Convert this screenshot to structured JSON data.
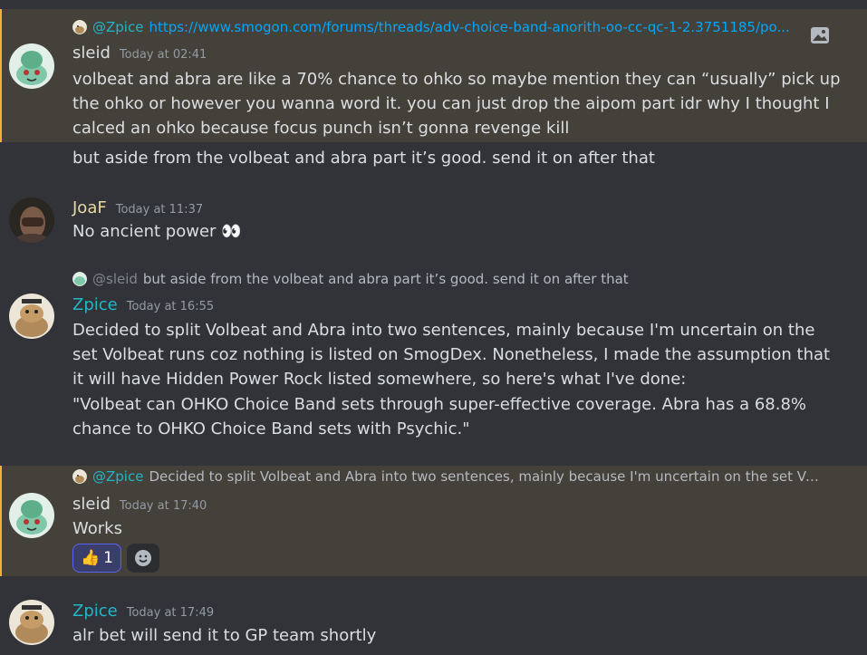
{
  "users": {
    "sleid": {
      "name": "sleid"
    },
    "joaf": {
      "name": "JoaF"
    },
    "zpice": {
      "name": "Zpice"
    }
  },
  "messages": [
    {
      "author": "sleid",
      "timestamp": "Today at 02:41",
      "reply": {
        "mention": "@Zpice",
        "text": "https://www.smogon.com/forums/threads/adv-choice-band-anorith-oo-cc-qc-1-2.3751185/po..."
      },
      "text": "volbeat and abra are like a 70% chance to ohko so maybe mention they can “usually” pick up the ohko or however you wanna word it. you can just drop the aipom part idr why I thought I calced an ohko because focus punch isn’t gonna revenge kill",
      "followup": "but aside from the volbeat and abra part it’s good. send it on after that"
    },
    {
      "author": "JoaF",
      "timestamp": "Today at 11:37",
      "text": "No ancient power 👀"
    },
    {
      "author": "Zpice",
      "timestamp": "Today at 16:55",
      "reply": {
        "mention": "@sleid",
        "text": "but aside from the volbeat and abra part it’s good. send it on after that"
      },
      "text": "Decided to split Volbeat and Abra into two sentences, mainly because I'm uncertain on the set Volbeat runs coz nothing is listed on SmogDex. Nonetheless, I made the assumption that it will have Hidden Power Rock listed somewhere, so here's what I've done:",
      "quote": "\"Volbeat can OHKO Choice Band sets through super-effective coverage. Abra has a 68.8% chance to OHKO Choice Band sets with Psychic.\""
    },
    {
      "author": "sleid",
      "timestamp": "Today at 17:40",
      "reply": {
        "mention": "@Zpice",
        "text": "Decided to split Volbeat and Abra into two sentences, mainly because I'm uncertain on the set Volb..."
      },
      "text": "Works",
      "reactions": [
        {
          "emoji": "👍",
          "count": "1"
        }
      ]
    },
    {
      "author": "Zpice",
      "timestamp": "Today at 17:49",
      "text": "alr bet will send it to GP team shortly"
    }
  ],
  "icons": {
    "embed": "image-icon",
    "add_reaction": "smiley-icon"
  },
  "colors": {
    "background": "#313338",
    "mention_highlight": "#44403a",
    "link": "#00a8fc",
    "zpice": "#22b6c9",
    "joaf": "#e8d9a4",
    "reaction_border": "#5865f2"
  }
}
